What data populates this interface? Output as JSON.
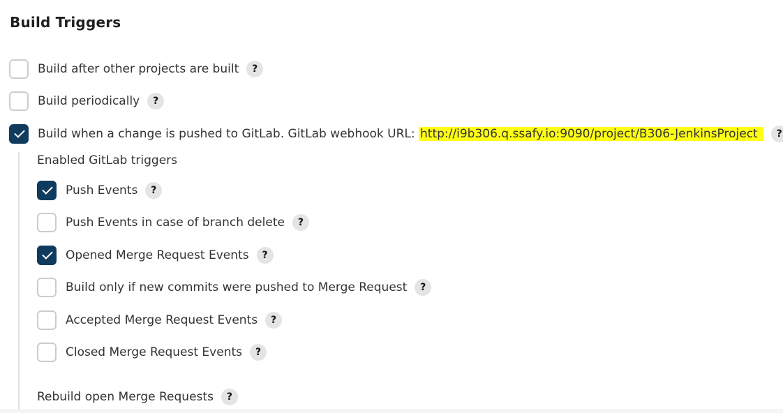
{
  "section": {
    "title": "Build Triggers"
  },
  "help_glyph": "?",
  "triggers": {
    "build_after": {
      "label": "Build after other projects are built",
      "checked": false
    },
    "periodically": {
      "label": "Build periodically",
      "checked": false
    },
    "gitlab": {
      "label": "Build when a change is pushed to GitLab. GitLab webhook URL: ",
      "url": "http://i9b306.q.ssafy.io:9090/project/B306-JenkinsProject",
      "checked": true
    }
  },
  "gitlab_triggers": {
    "heading": "Enabled GitLab triggers",
    "items": [
      {
        "label": "Push Events",
        "checked": true
      },
      {
        "label": "Push Events in case of branch delete",
        "checked": false
      },
      {
        "label": "Opened Merge Request Events",
        "checked": true
      },
      {
        "label": "Build only if new commits were pushed to Merge Request",
        "checked": false
      },
      {
        "label": "Accepted Merge Request Events",
        "checked": false
      },
      {
        "label": "Closed Merge Request Events",
        "checked": false
      }
    ],
    "rebuild_label": "Rebuild open Merge Requests"
  },
  "colors": {
    "checked": "#0f3b5e",
    "highlight": "#ffff14",
    "unchecked_border": "#c9cdd1"
  }
}
